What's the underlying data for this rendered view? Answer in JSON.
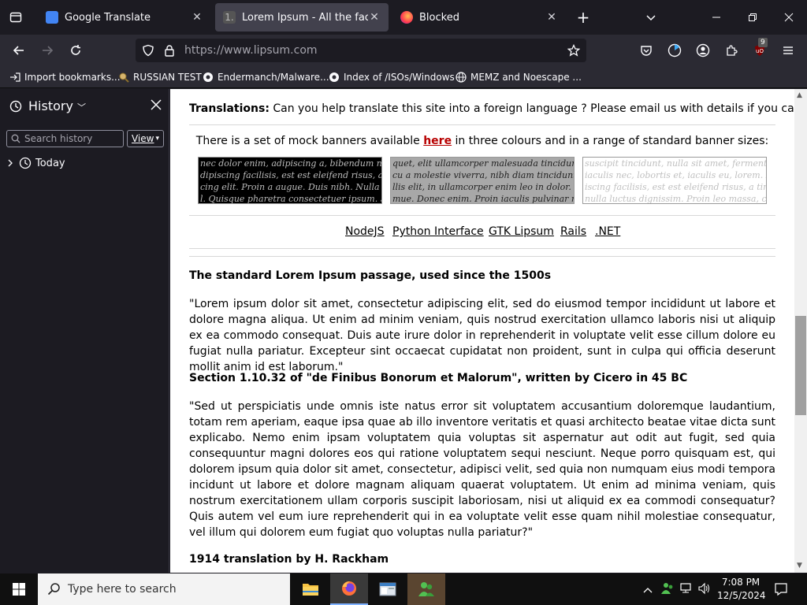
{
  "tabs": [
    {
      "title": "Google Translate",
      "active": false
    },
    {
      "title": "Lorem Ipsum - All the facts - Li",
      "active": true
    },
    {
      "title": "Blocked",
      "active": false
    }
  ],
  "nav": {
    "url": "https://www.lipsum.com",
    "extension_badge": "9"
  },
  "bookmarks": [
    "Import bookmarks...",
    "RUSSIAN TEST",
    "Endermanch/Malware...",
    "Index of /ISOs/Windows",
    "MEMZ and Noescape ..."
  ],
  "sidebar": {
    "title": "History",
    "search_placeholder": "Search history",
    "view_label": "View",
    "groups": [
      "Today"
    ]
  },
  "page": {
    "translations_label": "Translations:",
    "translations_text": " Can you help translate this site into a foreign language ? Please email us with details if you can help.",
    "banners_before": "There is a set of mock banners available ",
    "banners_link": "here",
    "banners_after": " in three colours and in a range of standard banner sizes:",
    "banner_lines": [
      "nec dolor enim, adipiscing a, bibendum non, co",
      "dipiscing facilisis, est est eleifend risus, a tincid",
      "cing elit. Proin a augue. Duis nibh. Nulla iacul",
      "l. Quisque pharetra consectetuer ipsum. Sed "
    ],
    "banner_lines_gray": [
      "quet, elit ullamcorper malesuada tincidunt, t",
      "cu a molestie viverra, nibh diam tincidunt, ul",
      "llis elit, in ullamcorper enim leo in dolor. Et i",
      "mue. Donec enim. Proin iaculis pulvinar nib"
    ],
    "banner_lines_white": [
      "suscipit tincidunt, nulla sit amet, fermentum",
      "iaculis nec, lobortis et, iaculis eu, lorem. Nam",
      "iscing facilisis, est est eleifend risus, a tincid",
      "nulla luctus dignissim. Proin leo massa, conva"
    ],
    "links": [
      "NodeJS",
      "Python Interface",
      "GTK Lipsum",
      "Rails",
      ".NET"
    ],
    "h1": "The standard Lorem Ipsum passage, used since the 1500s",
    "p1": "\"Lorem ipsum dolor sit amet, consectetur adipiscing elit, sed do eiusmod tempor incididunt ut labore et dolore magna aliqua. Ut enim ad minim veniam, quis nostrud exercitation ullamco laboris nisi ut aliquip ex ea commodo consequat. Duis aute irure dolor in reprehenderit in voluptate velit esse cillum dolore eu fugiat nulla pariatur. Excepteur sint occaecat cupidatat non proident, sunt in culpa qui officia deserunt mollit anim id est laborum.\"",
    "h2": "Section 1.10.32 of \"de Finibus Bonorum et Malorum\", written by Cicero in 45 BC",
    "p2": "\"Sed ut perspiciatis unde omnis iste natus error sit voluptatem accusantium doloremque laudantium, totam rem aperiam, eaque ipsa quae ab illo inventore veritatis et quasi architecto beatae vitae dicta sunt explicabo. Nemo enim ipsam voluptatem quia voluptas sit aspernatur aut odit aut fugit, sed quia consequuntur magni dolores eos qui ratione voluptatem sequi nesciunt. Neque porro quisquam est, qui dolorem ipsum quia dolor sit amet, consectetur, adipisci velit, sed quia non numquam eius modi tempora incidunt ut labore et dolore magnam aliquam quaerat voluptatem. Ut enim ad minima veniam, quis nostrum exercitationem ullam corporis suscipit laboriosam, nisi ut aliquid ex ea commodi consequatur? Quis autem vel eum iure reprehenderit qui in ea voluptate velit esse quam nihil molestiae consequatur, vel illum qui dolorem eum fugiat quo voluptas nulla pariatur?\"",
    "h3": "1914 translation by H. Rackham"
  },
  "taskbar": {
    "search_placeholder": "Type here to search",
    "time": "7:08 PM",
    "date": "12/5/2024"
  },
  "colors": {
    "accent_link": "#b70000"
  }
}
